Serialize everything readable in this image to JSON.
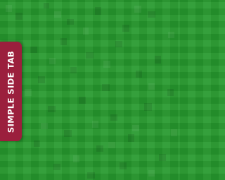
{
  "side_tab": {
    "label": "SIMPLE SIDE TAB",
    "color": "#9b1f3d",
    "text_color": "#ffffff"
  },
  "background": {
    "color": "#279a2e",
    "pattern": "pixel-mosaic"
  }
}
